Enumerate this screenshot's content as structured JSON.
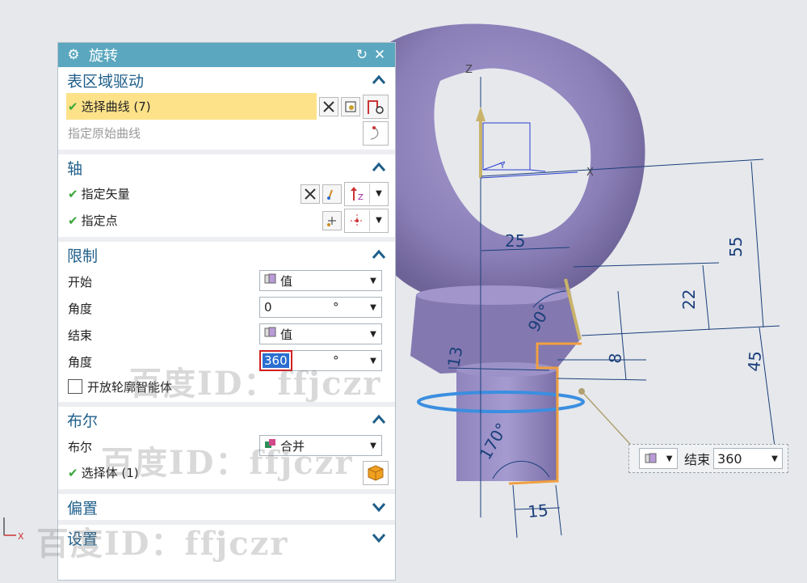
{
  "dialog": {
    "title": "旋转",
    "reset_icon": "reset-icon",
    "close_icon": "close-icon",
    "gear_icon": "gear-icon",
    "sections": {
      "section_drive": {
        "title": "表区域驱动",
        "select_curve": "选择曲线 (7)",
        "specify_origin_curve": "指定原始曲线"
      },
      "axis": {
        "title": "轴",
        "specify_vector": "指定矢量",
        "specify_point": "指定点"
      },
      "limits": {
        "title": "限制",
        "start_label": "开始",
        "start_mode": "值",
        "start_angle_label": "角度",
        "start_angle_value": "0",
        "start_angle_unit": "°",
        "end_label": "结束",
        "end_mode": "值",
        "end_angle_label": "角度",
        "end_angle_value": "360",
        "end_angle_unit": "°",
        "open_profile_label": "开放轮廓智能体"
      },
      "boolean": {
        "title": "布尔",
        "bool_label": "布尔",
        "bool_value": "合并",
        "select_body": "选择体 (1)"
      },
      "offset": {
        "title": "偏置"
      },
      "settings": {
        "title": "设置"
      }
    }
  },
  "minibar": {
    "label": "结束",
    "value": "360"
  },
  "canvas": {
    "axis_labels": {
      "z": "Z",
      "x": "X",
      "y": "Y",
      "triad_x": "X"
    },
    "dimensions": [
      "25",
      "55",
      "22",
      "90°",
      "13",
      "8",
      "45",
      "170°",
      "15"
    ]
  },
  "watermark": "百度ID：ffjczr",
  "colors": {
    "titlebar": "#5aa7bf",
    "section_title": "#1f5f8a",
    "highlight": "#fde28a",
    "model": "#8d80b8",
    "dimension": "#1b3f7a"
  }
}
